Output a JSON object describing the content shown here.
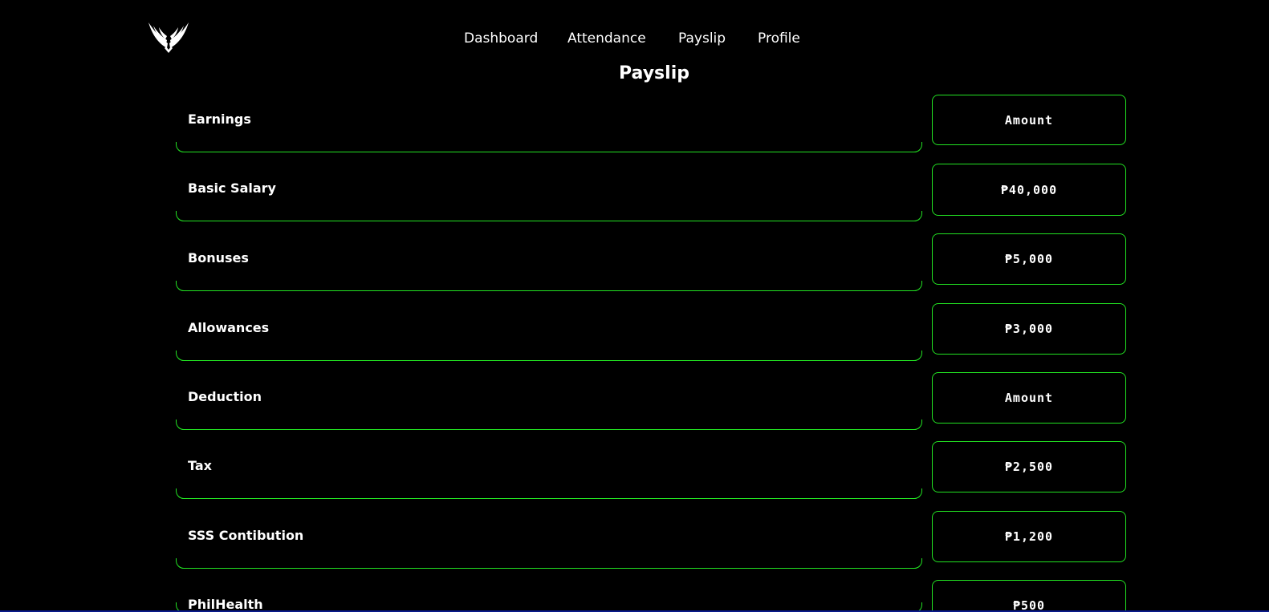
{
  "nav": {
    "items": [
      {
        "label": "Dashboard"
      },
      {
        "label": "Attendance"
      },
      {
        "label": "Payslip"
      },
      {
        "label": "Profile"
      }
    ]
  },
  "logo": {
    "icon": "winged-emblem-icon"
  },
  "page": {
    "title": "Payslip"
  },
  "rows": [
    {
      "label": "Earnings",
      "amount": "Amount"
    },
    {
      "label": "Basic Salary",
      "amount": "₱40,000"
    },
    {
      "label": "Bonuses",
      "amount": "₱5,000"
    },
    {
      "label": "Allowances",
      "amount": "₱3,000"
    },
    {
      "label": "Deduction",
      "amount": "Amount"
    },
    {
      "label": "Tax",
      "amount": "₱2,500"
    },
    {
      "label": "SSS Contibution",
      "amount": "₱1,200"
    },
    {
      "label": "PhilHealth",
      "amount": "₱500"
    }
  ],
  "colors": {
    "background": "#000000",
    "accent": "#22e222",
    "text": "#ffffff"
  }
}
